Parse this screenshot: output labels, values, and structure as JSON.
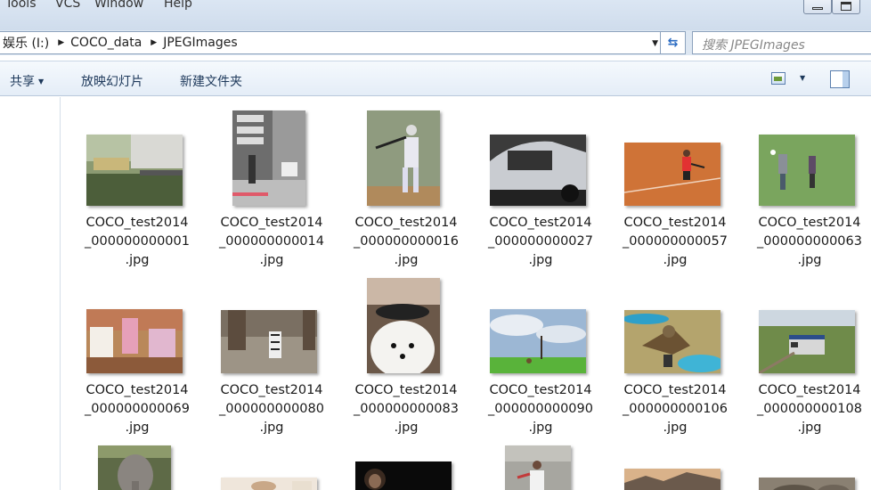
{
  "menu": {
    "items": [
      "Tools",
      "VCS",
      "Window",
      "Help"
    ]
  },
  "address": {
    "crumbs": [
      "娱乐 (I:)",
      "COCO_data",
      "JPEGImages"
    ],
    "search_placeholder": "搜索 JPEGImages"
  },
  "toolbar": {
    "share_label": "共享",
    "slideshow_label": "放映幻灯片",
    "new_folder_label": "新建文件夹"
  },
  "files": [
    {
      "label": "COCO_test2014\n_000000000001\n.jpg",
      "icon": "street-truck-image"
    },
    {
      "label": "COCO_test2014\n_000000000014\n.jpg",
      "icon": "street-bw-image"
    },
    {
      "label": "COCO_test2014\n_000000000016\n.jpg",
      "icon": "baseball-image"
    },
    {
      "label": "COCO_test2014\n_000000000027\n.jpg",
      "icon": "car-image"
    },
    {
      "label": "COCO_test2014\n_000000000057\n.jpg",
      "icon": "tennis-clay-image"
    },
    {
      "label": "COCO_test2014\n_000000000063\n.jpg",
      "icon": "frisbee-field-image"
    },
    {
      "label": "COCO_test2014\n_000000000069\n.jpg",
      "icon": "dining-people-image"
    },
    {
      "label": "COCO_test2014\n_000000000080\n.jpg",
      "icon": "zebra-image"
    },
    {
      "label": "COCO_test2014\n_000000000083\n.jpg",
      "icon": "dog-image"
    },
    {
      "label": "COCO_test2014\n_000000000090\n.jpg",
      "icon": "landscape-tree-image"
    },
    {
      "label": "COCO_test2014\n_000000000106\n.jpg",
      "icon": "hawk-image"
    },
    {
      "label": "COCO_test2014\n_000000000108\n.jpg",
      "icon": "train-image"
    },
    {
      "label": "",
      "icon": "elephant-image"
    },
    {
      "label": "",
      "icon": "food-image"
    },
    {
      "label": "",
      "icon": "dark-portrait-image"
    },
    {
      "label": "",
      "icon": "tennis-player-image"
    },
    {
      "label": "",
      "icon": "mountain-sunset-image"
    },
    {
      "label": "",
      "icon": "rocks-image"
    }
  ]
}
